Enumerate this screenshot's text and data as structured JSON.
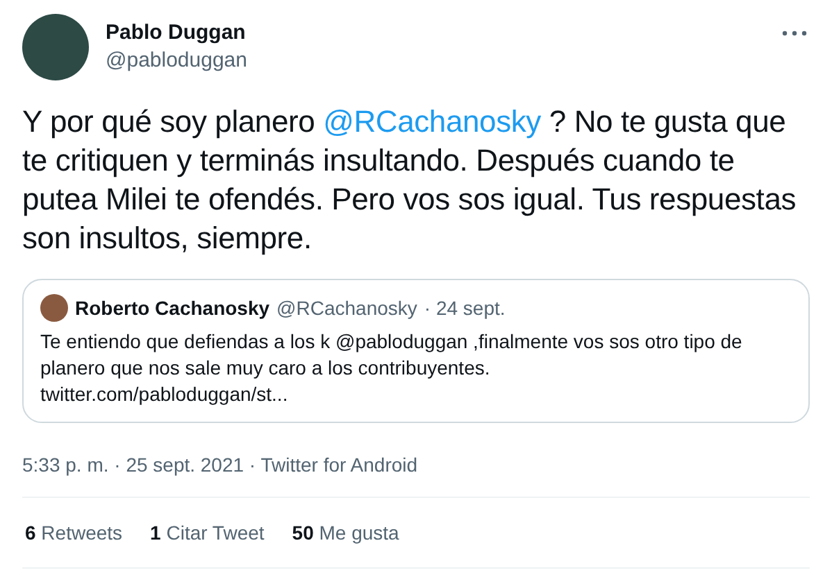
{
  "author": {
    "name": "Pablo Duggan",
    "handle": "@pabloduggan"
  },
  "tweet": {
    "text_before": "Y por qué soy planero",
    "mention": "@RCachanosky",
    "text_after": "? No te gusta que te critiquen y terminás insultando. Después cuando te putea Milei te ofendés. Pero vos sos igual. Tus respuestas son insultos, siempre."
  },
  "quote": {
    "name": "Roberto Cachanosky",
    "handle": "@RCachanosky",
    "date": "· 24 sept.",
    "text_before": "Te entiendo que defiendas a los k",
    "mention": "@pabloduggan",
    "text_after": ",finalmente vos sos otro tipo de planero que nos sale muy caro a los contribuyentes.",
    "link": "twitter.com/pabloduggan/st..."
  },
  "meta": "5:33 p. m. · 25 sept. 2021 · Twitter for Android",
  "stats": [
    {
      "count": "6",
      "label": "Retweets"
    },
    {
      "count": "1",
      "label": "Citar Tweet"
    },
    {
      "count": "50",
      "label": "Me gusta"
    }
  ]
}
